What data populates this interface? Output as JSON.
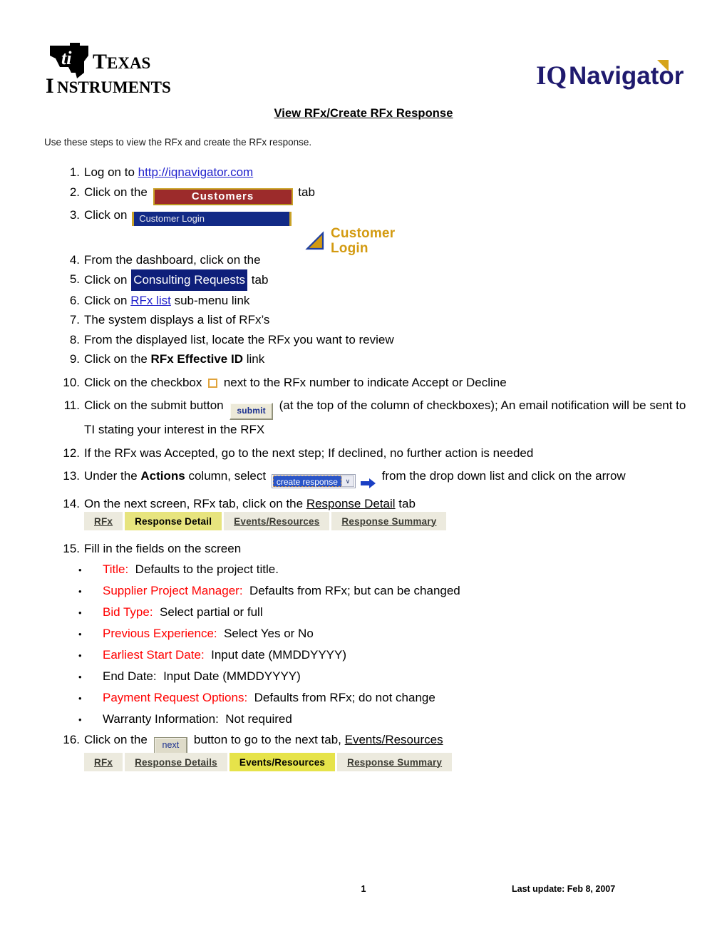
{
  "header": {
    "ti_logo_alt": "TEXAS INSTRUMENTS",
    "ti_line1": "TEXAS",
    "ti_line2": "INSTRUMENTS",
    "iq_logo_alt": "IQNavigator",
    "iq_part1": "IQ",
    "iq_part2": "Navigator"
  },
  "title": "View RFx/Create RFx Response",
  "intro": "Use these steps to view the RFx and create the RFx response.",
  "steps": [
    {
      "num": "1.",
      "pre": "Log on to ",
      "link": "http://iqnavigator.com",
      "post": ""
    },
    {
      "num": "2.",
      "pre": "Click on the ",
      "widget": "Customers",
      "post": " tab"
    },
    {
      "num": "3.",
      "pre": "Click on ",
      "widget": "Customer Login",
      "post": ""
    },
    {
      "num": "4.",
      "pre": "From the dashboard, click on the ",
      "post": ""
    },
    {
      "num": "5.",
      "pre": "Click on ",
      "highlight": "Consulting Requests",
      "post": " tab"
    },
    {
      "num": "6.",
      "pre": "Click on ",
      "link": "RFx list",
      "post": " sub-menu link"
    },
    {
      "num": "7.",
      "text": "The system displays a list of RFx’s"
    },
    {
      "num": "8.",
      "text": "From the displayed list, locate the RFx you want to review"
    },
    {
      "num": "9.",
      "pre": "Click on the ",
      "bold": "RFx Effective ID",
      "post": " link"
    },
    {
      "num": "10.",
      "pre": "Click on the checkbox ",
      "post": " next to the RFx number to indicate Accept or Decline"
    },
    {
      "num": "11.",
      "pre": "Click on the submit button ",
      "widget": "submit",
      "post": " (at the top of the column of checkboxes); An email notification will be sent to TI stating your interest in the RFX"
    },
    {
      "num": "12.",
      "text": "If the RFx was Accepted, go to the next step; If declined, no further action is needed"
    },
    {
      "num": "13.",
      "pre": "Under the ",
      "bold": "Actions",
      "mid": " column, select ",
      "widget": "create response",
      "post": " from the drop down list and click on the arrow"
    },
    {
      "num": "14.",
      "pre": "On the next screen, RFx tab, click on the ",
      "underline": "Response Detail",
      "post": " tab"
    },
    {
      "num": "15.",
      "text": "Fill in the fields on the screen"
    },
    {
      "num": "16.",
      "pre": "Click on the ",
      "widget": "next",
      "mid": " button to go to the next tab, ",
      "underline": "Events/Resources"
    }
  ],
  "customer_login_graphic": {
    "line1": "Customer",
    "line2": "Login",
    "color": "#d39a10"
  },
  "dropdown": {
    "selected": "create response",
    "chevron": "∨",
    "arrow_icon": "right-arrow-icon",
    "arrow_color": "#1a3fc4"
  },
  "tabstrip_1": {
    "tabs": [
      {
        "label": "RFx",
        "active": false
      },
      {
        "label": "Response Detail",
        "active": true
      },
      {
        "label": "Events/Resources",
        "active": false
      },
      {
        "label": "Response Summary",
        "active": false
      }
    ]
  },
  "tabstrip_2": {
    "tabs": [
      {
        "label": "RFx",
        "active": false
      },
      {
        "label": "Response Details",
        "active": false
      },
      {
        "label": "Events/Resources",
        "active": true
      },
      {
        "label": "Response Summary",
        "active": false
      }
    ]
  },
  "bullets": [
    {
      "marker": "•",
      "label": "Title:",
      "label_red": true,
      "desc": "Defaults to the project title."
    },
    {
      "marker": "•",
      "label": "Supplier Project Manager:",
      "label_red": true,
      "desc": "Defaults from RFx; but can be changed"
    },
    {
      "marker": "•",
      "label": "Bid Type:",
      "label_red": true,
      "desc": "Select partial or full"
    },
    {
      "marker": "•",
      "label": "Previous Experience:",
      "label_red": true,
      "desc": "Select Yes or No"
    },
    {
      "marker": "•",
      "label": "Earliest Start Date:",
      "label_red": true,
      "desc": "Input date (MMDDYYYY)"
    },
    {
      "marker": "•",
      "label": "End Date:",
      "label_red": false,
      "desc": "Input Date (MMDDYYYY)"
    },
    {
      "marker": "•",
      "label": "Payment Request Options:",
      "label_red": true,
      "desc": "Defaults from RFx; do not change"
    },
    {
      "marker": "•",
      "label": "Warranty Information:",
      "label_red": false,
      "desc": "Not required"
    }
  ],
  "footer": {
    "page_number": "1",
    "last_update": "Last update: Feb 8, 2007"
  },
  "colors": {
    "customers_tab_bg": "#9c2b2b",
    "customers_tab_border": "#c9a227",
    "customer_login_bg": "#122a86",
    "highlight_bg": "#0e1f7a",
    "tab_inactive_bg": "#eceade",
    "tab_active_bg": "#e7e47e",
    "red_label": "#ff0000",
    "link_blue": "#2222cc",
    "iq_navy": "#1f1a6e",
    "iq_gold": "#d6a419"
  }
}
